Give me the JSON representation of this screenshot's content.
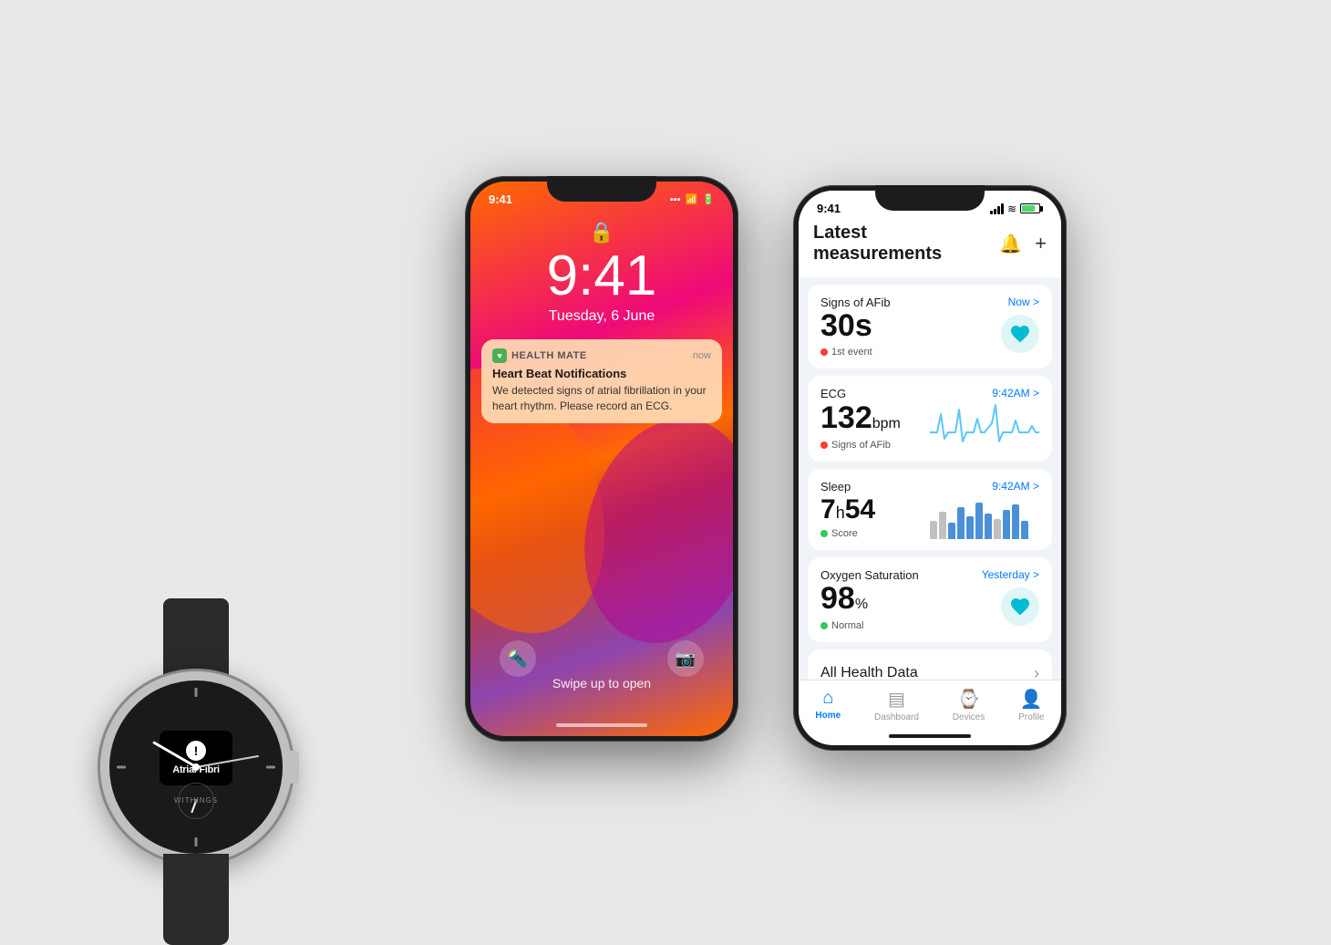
{
  "background": "#e8e8e8",
  "watch": {
    "brand": "WITHINGS",
    "alert_text": "Atrial Fibri",
    "alert_icon": "!"
  },
  "lockscreen": {
    "time": "9:41",
    "status_time": "9:41",
    "date": "Tuesday, 6 June",
    "swipe_text": "Swipe up to open",
    "notification": {
      "app_name": "HEALTH MATE",
      "time": "now",
      "title": "Heart Beat Notifications",
      "body": "We detected signs of atrial fibrillation in your heart rhythm. Please record an ECG."
    }
  },
  "app": {
    "status_time": "9:41",
    "title": "Latest measurements",
    "measurements": [
      {
        "id": "afib",
        "label": "Signs of AFib",
        "time": "Now",
        "value": "30s",
        "badge_label": "1st event",
        "badge_color": "#ff3b30",
        "has_heart_icon": true
      },
      {
        "id": "ecg",
        "label": "ECG",
        "time": "9:42AM",
        "value": "132",
        "unit": "bpm",
        "badge_label": "Signs of AFib",
        "badge_color": "#ff3b30",
        "has_ecg_chart": true
      },
      {
        "id": "sleep",
        "label": "Sleep",
        "time": "9:42AM",
        "value_h": "7",
        "value_m": "54",
        "badge_label": "Score",
        "badge_color": "#34c759",
        "has_sleep_chart": true
      },
      {
        "id": "oxygen",
        "label": "Oxygen Saturation",
        "time": "Yesterday",
        "value": "98",
        "unit": "%",
        "badge_label": "Normal",
        "badge_color": "#34c759",
        "has_heart_icon": true
      }
    ],
    "all_health": "All Health Data",
    "tabs": [
      {
        "id": "home",
        "label": "Home",
        "active": true
      },
      {
        "id": "dashboard",
        "label": "Dashboard",
        "active": false
      },
      {
        "id": "devices",
        "label": "Devices",
        "active": false
      },
      {
        "id": "profile",
        "label": "Profile",
        "active": false
      }
    ]
  }
}
